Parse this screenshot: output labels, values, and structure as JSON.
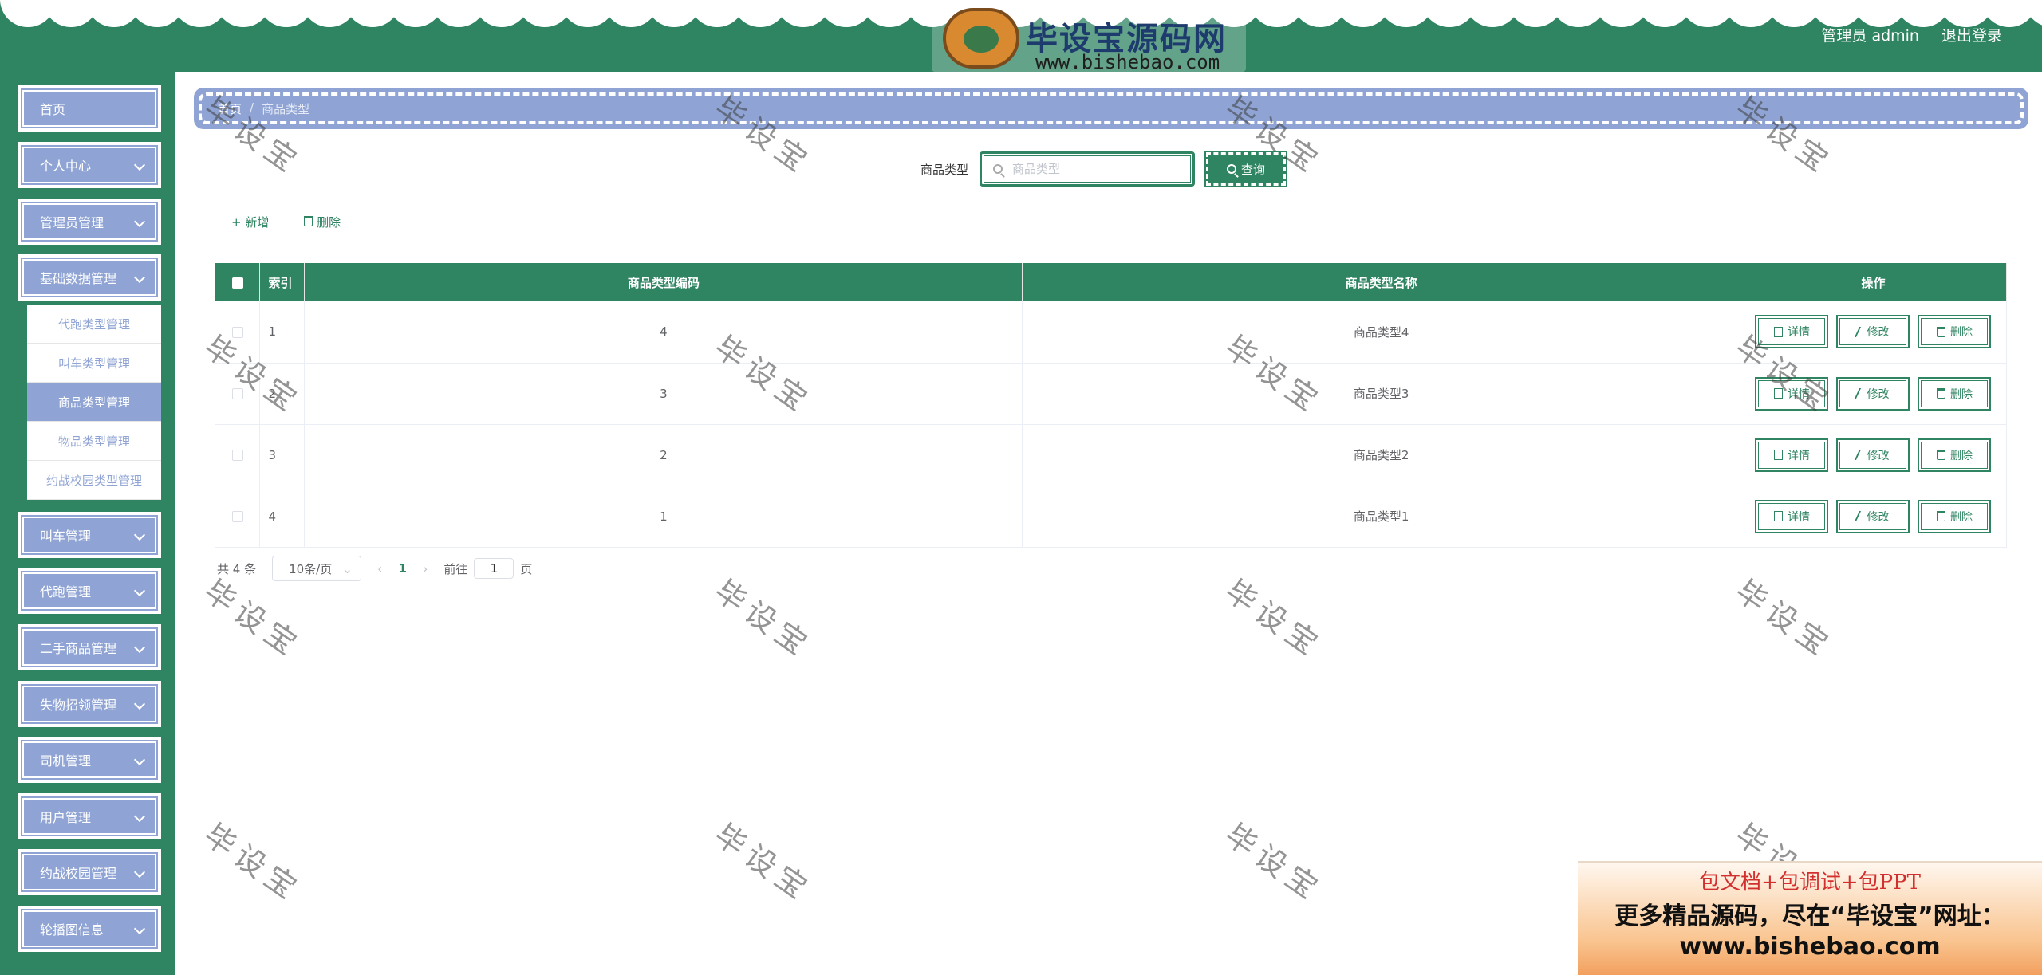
{
  "header": {
    "logo_title": "毕设宝源码网",
    "logo_url": "www.bishebao.com",
    "user_label": "管理员 admin",
    "logout_label": "退出登录"
  },
  "sidebar": {
    "items": [
      {
        "label": "首页",
        "has_children": false
      },
      {
        "label": "个人中心",
        "has_children": true
      },
      {
        "label": "管理员管理",
        "has_children": true
      },
      {
        "label": "基础数据管理",
        "has_children": true,
        "expanded": true
      }
    ],
    "submenu": [
      {
        "label": "代跑类型管理"
      },
      {
        "label": "叫车类型管理"
      },
      {
        "label": "商品类型管理",
        "active": true
      },
      {
        "label": "物品类型管理"
      },
      {
        "label": "约战校园类型管理"
      }
    ],
    "items_after": [
      {
        "label": "叫车管理"
      },
      {
        "label": "代跑管理"
      },
      {
        "label": "二手商品管理"
      },
      {
        "label": "失物招领管理"
      },
      {
        "label": "司机管理"
      },
      {
        "label": "用户管理"
      },
      {
        "label": "约战校园管理"
      },
      {
        "label": "轮播图信息"
      }
    ]
  },
  "breadcrumb": {
    "home": "首页",
    "separator": "/",
    "current": "商品类型"
  },
  "search": {
    "label": "商品类型",
    "placeholder": "商品类型",
    "button_label": "查询"
  },
  "toolbar": {
    "add_label": "+ 新增",
    "delete_label": "删除"
  },
  "table": {
    "headers": [
      "索引",
      "商品类型编码",
      "商品类型名称",
      "操作"
    ],
    "rows": [
      {
        "index": "1",
        "code": "4",
        "name": "商品类型4"
      },
      {
        "index": "2",
        "code": "3",
        "name": "商品类型3"
      },
      {
        "index": "3",
        "code": "2",
        "name": "商品类型2"
      },
      {
        "index": "4",
        "code": "1",
        "name": "商品类型1"
      }
    ],
    "actions": {
      "detail": "详情",
      "edit": "修改",
      "delete": "删除"
    }
  },
  "pagination": {
    "total": "共 4 条",
    "page_size": "10条/页",
    "current_page": "1",
    "goto_prefix": "前往",
    "goto_value": "1",
    "goto_suffix": "页"
  },
  "watermark": "毕设宝",
  "ad": {
    "line1": "包文档+包调试+包PPT",
    "line2": "更多精品源码，尽在“毕设宝”网址：",
    "line3": "www.bishebao.com"
  },
  "colors": {
    "primary": "#2f8462",
    "menu": "#8fa4d4",
    "ad_red": "#d2302f"
  }
}
